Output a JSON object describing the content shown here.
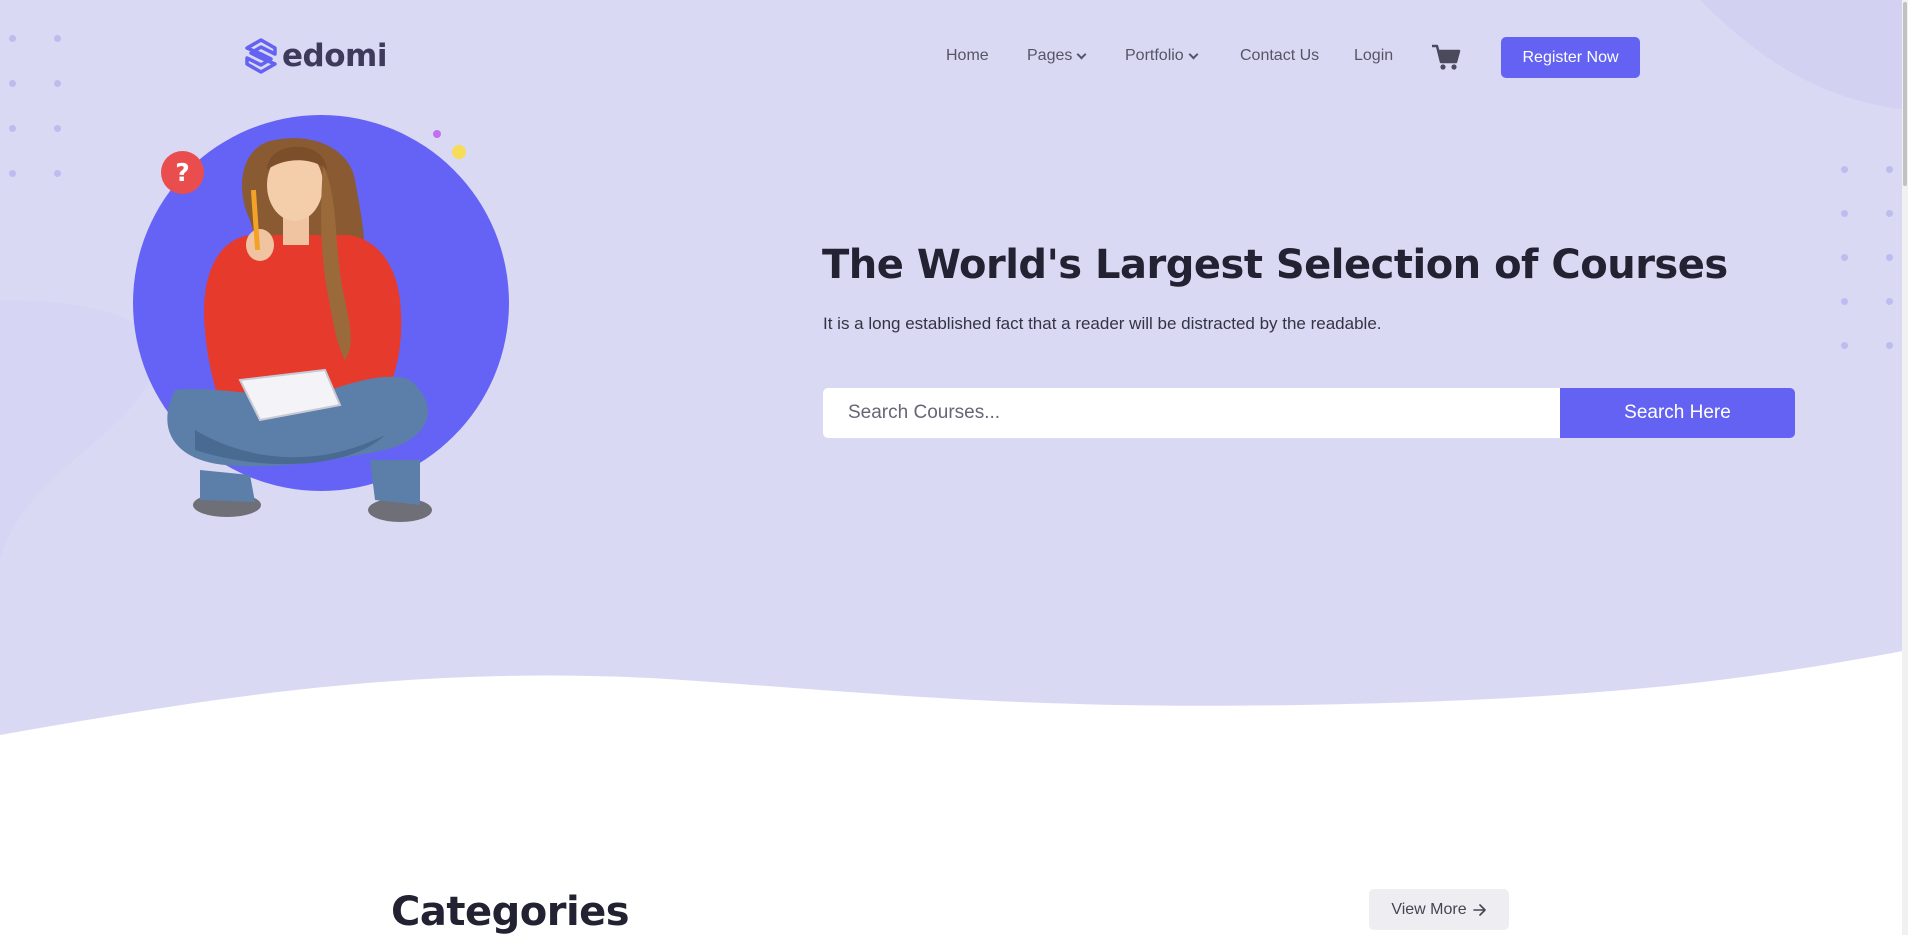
{
  "brand": {
    "name": "edomi",
    "logo_icon": "s-logo-icon"
  },
  "nav": {
    "items": [
      {
        "label": "Home",
        "has_dropdown": false
      },
      {
        "label": "Pages",
        "has_dropdown": true
      },
      {
        "label": "Portfolio",
        "has_dropdown": true
      },
      {
        "label": "Contact Us",
        "has_dropdown": false
      },
      {
        "label": "Login",
        "has_dropdown": false
      }
    ],
    "cart_icon": "cart-icon",
    "register_label": "Register Now"
  },
  "hero": {
    "title": "The World's Largest Selection of Courses",
    "subtitle": "It is a long established fact that a reader will be distracted by the readable.",
    "badge_symbol": "?",
    "search": {
      "placeholder": "Search Courses...",
      "value": "",
      "button_label": "Search Here"
    }
  },
  "categories": {
    "title": "Categories",
    "view_more_label": "View More",
    "view_more_icon": "arrow-right-icon"
  },
  "colors": {
    "accent": "#6462f2",
    "hero_bg": "#dad9f4",
    "badge_red": "#ea4d4d",
    "heading": "#222233"
  }
}
